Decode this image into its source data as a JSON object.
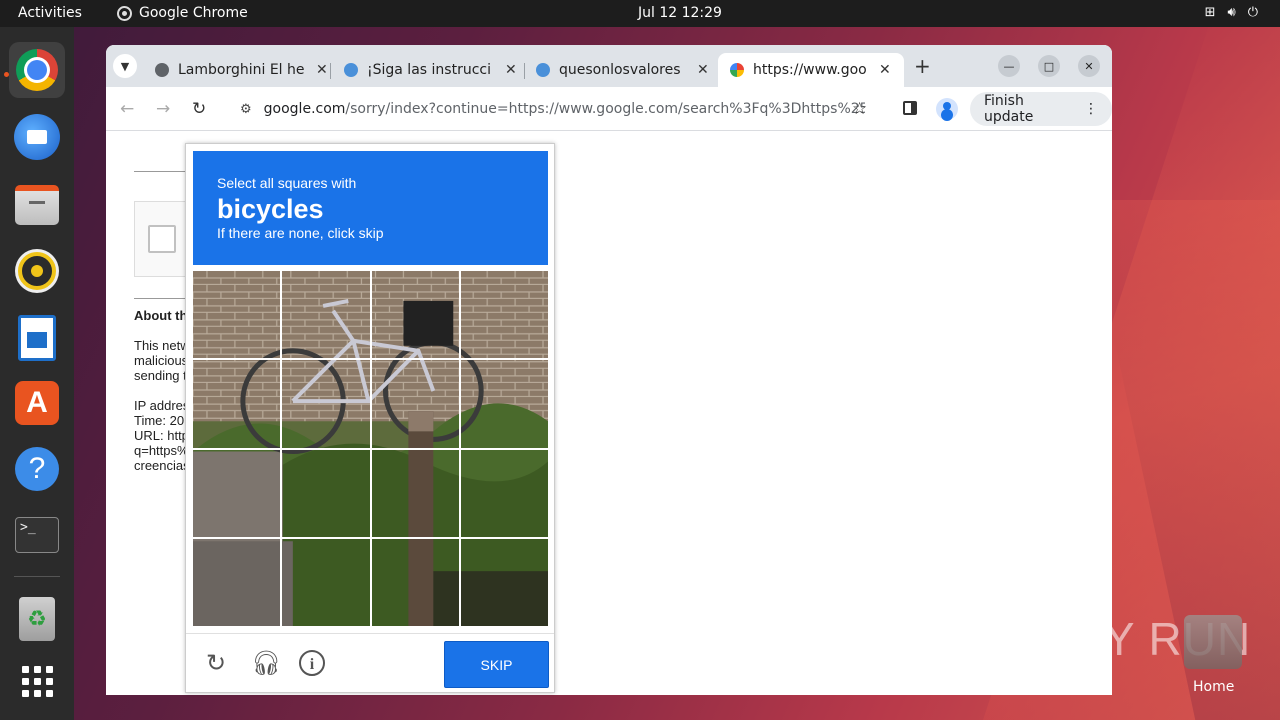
{
  "topbar": {
    "activities": "Activities",
    "app_name": "Google Chrome",
    "clock": "Jul 12  12:29"
  },
  "dock": {
    "items": [
      "google-chrome",
      "thunderbird",
      "files",
      "rhythmbox",
      "libreoffice-writer",
      "app-center",
      "help",
      "terminal",
      "trash",
      "show-apps"
    ]
  },
  "desktop": {
    "home_label": "Home",
    "watermark": "ANY RUN"
  },
  "browser": {
    "tabs": [
      {
        "title": "Lamborghini El he",
        "icon": "globe-icon",
        "active": false
      },
      {
        "title": "¡Siga las instrucci",
        "icon": "download-cloud-icon",
        "active": false
      },
      {
        "title": "quesonlosvalores",
        "icon": "download-cloud-icon",
        "active": false
      },
      {
        "title": "https://www.goo",
        "icon": "google-icon",
        "active": true
      }
    ],
    "new_tab": "+",
    "url_host": "google.com",
    "url_path": "/sorry/index?continue=https://www.google.com/search%3Fq%3Dhttps%253A...",
    "finish_update": "Finish update"
  },
  "page": {
    "about": "About th",
    "lines": [
      "This netw",
      "malicious",
      "sending t",
      "",
      "IP addres",
      "Time: 20",
      "URL: http",
      "q=https%",
      "creencias"
    ]
  },
  "captcha": {
    "instruction": "Select all squares with",
    "target": "bicycles",
    "hint": "If there are none, click skip",
    "skip_label": "SKIP"
  },
  "colors": {
    "captcha_blue": "#1a73e8",
    "topbar": "#1d1d1d",
    "dock": "#2b2b2b",
    "accent": "#e95420"
  }
}
